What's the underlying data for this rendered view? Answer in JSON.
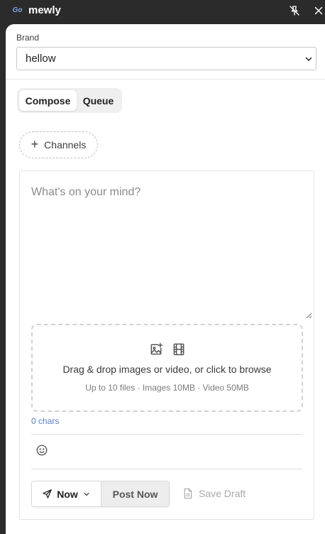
{
  "titlebar": {
    "logo_text": "Go",
    "title": "mewly",
    "icons": [
      "pin-off-icon",
      "close-icon"
    ]
  },
  "brand": {
    "label": "Brand",
    "selected": "hellow"
  },
  "tabs": [
    {
      "label": "Compose",
      "active": true
    },
    {
      "label": "Queue",
      "active": false
    }
  ],
  "channels_button": {
    "label": "Channels",
    "icon": "plus-icon"
  },
  "composer": {
    "placeholder": "What's on your mind?",
    "dropzone_text": "Drag & drop images or video, or click to browse",
    "dropzone_subtext": "Up to 10 files · Images 10MB · Video 50MB",
    "char_count": "0 chars"
  },
  "actions": {
    "schedule_label": "Now",
    "post_label": "Post Now",
    "save_draft_label": "Save Draft"
  },
  "colors": {
    "titlebar_bg": "#2b2b2b",
    "accent_link": "#5b7fc9",
    "logo": "#7ea3e8"
  }
}
